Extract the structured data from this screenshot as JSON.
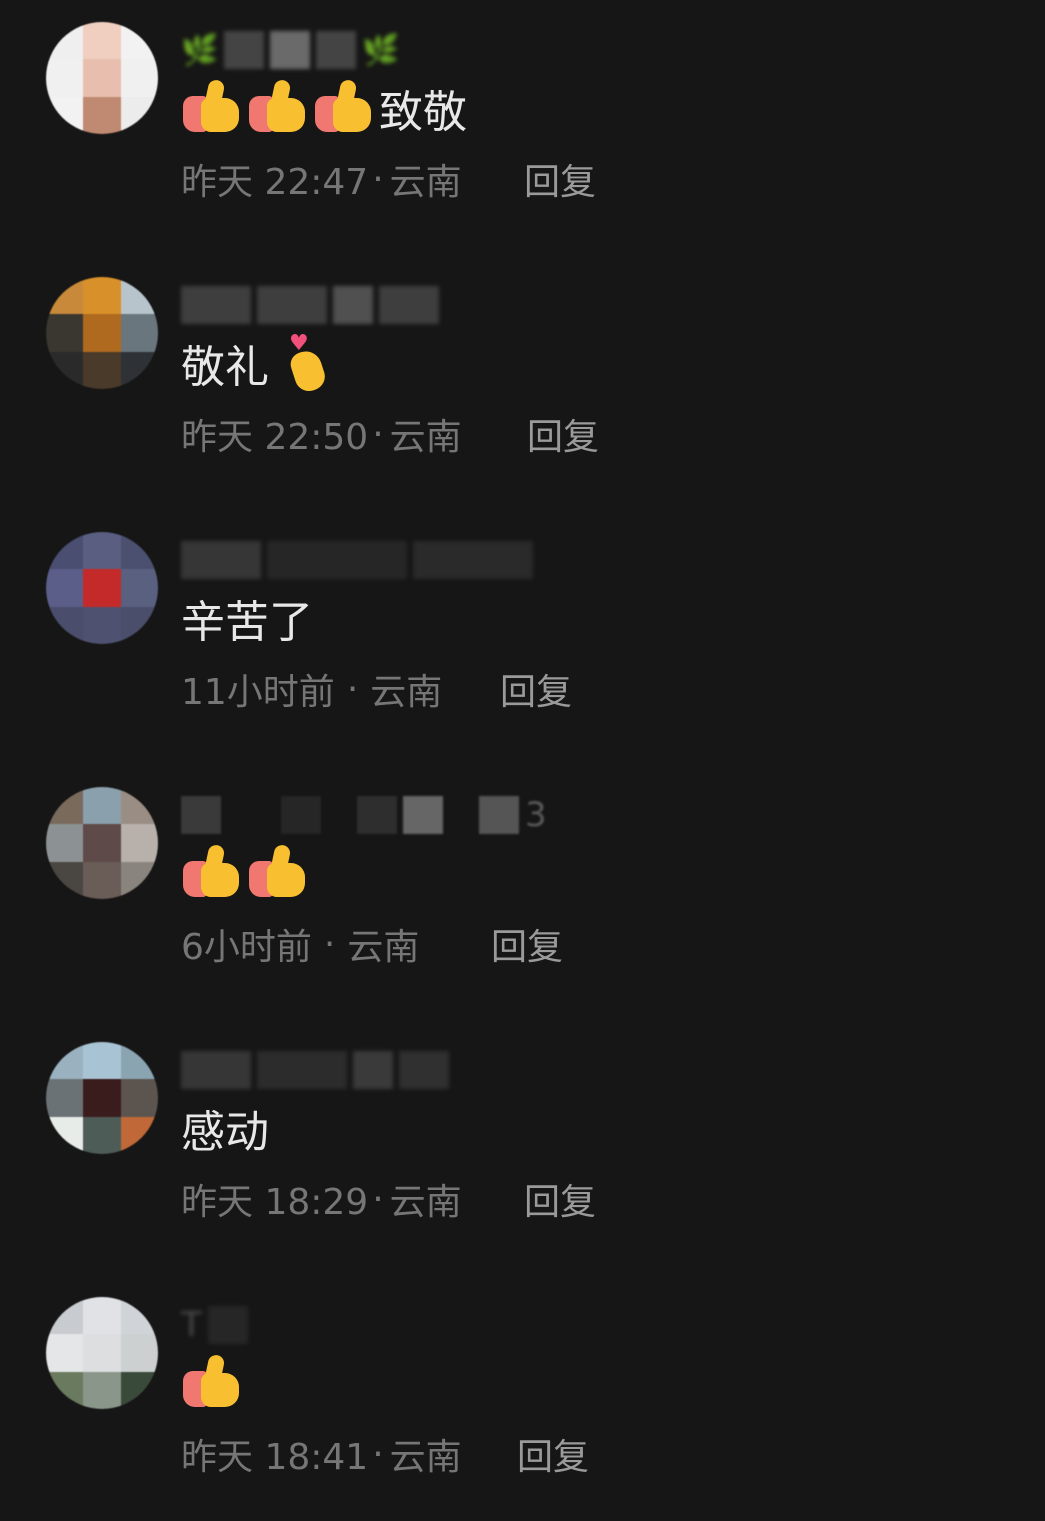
{
  "comments": [
    {
      "username_visible": "",
      "content": "致敬",
      "emoji_count": 3,
      "time": "昨天 22:47",
      "location": "云南",
      "reply_label": "回复"
    },
    {
      "username_visible": "",
      "content": "敬礼",
      "time": "昨天 22:50",
      "location": "云南",
      "reply_label": "回复"
    },
    {
      "username_visible": "",
      "content": "辛苦了",
      "time": "11小时前",
      "location": "云南",
      "reply_label": "回复"
    },
    {
      "username_visible": "3",
      "content": "",
      "emoji_count": 2,
      "time": "6小时前",
      "location": "云南",
      "reply_label": "回复"
    },
    {
      "username_visible": "",
      "content": "感动",
      "time": "昨天 18:29",
      "location": "云南",
      "reply_label": "回复"
    },
    {
      "username_visible": "T",
      "content": "",
      "emoji_count": 1,
      "time": "昨天 18:41",
      "location": "云南",
      "reply_label": "回复"
    }
  ],
  "separator": "·",
  "icons": {
    "thumbs_up": "thumbs-up-emoji",
    "finger_heart": "finger-heart-emoji",
    "leaf": "leaf-emoji"
  },
  "colors": {
    "background": "#161616",
    "content_text": "#e8e8e8",
    "meta_text": "#767676",
    "reply_text": "#9a9a9a"
  }
}
